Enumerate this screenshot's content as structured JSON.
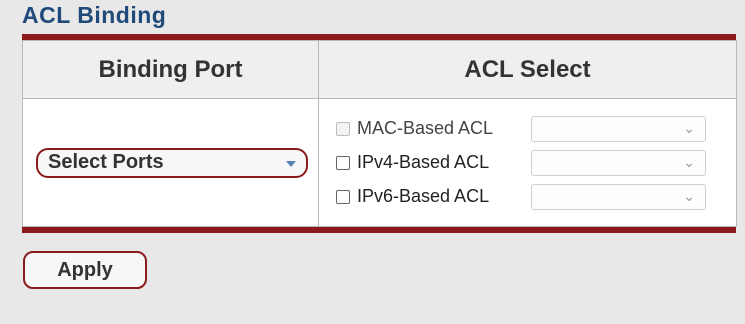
{
  "page": {
    "title": "ACL Binding"
  },
  "table": {
    "headers": {
      "binding_port": "Binding Port",
      "acl_select": "ACL Select"
    },
    "select_ports": {
      "label": "Select Ports",
      "icon": "chevron-down-icon"
    },
    "acl_options": [
      {
        "label": "MAC-Based ACL",
        "checked": false,
        "disabled": true,
        "dropdown_value": ""
      },
      {
        "label": "IPv4-Based ACL",
        "checked": false,
        "disabled": false,
        "dropdown_value": ""
      },
      {
        "label": "IPv6-Based ACL",
        "checked": false,
        "disabled": false,
        "dropdown_value": ""
      }
    ]
  },
  "actions": {
    "apply_label": "Apply"
  },
  "colors": {
    "accent_border": "#8b1a1a",
    "title_color": "#1f4a7a",
    "caret_color": "#5a84b5"
  }
}
